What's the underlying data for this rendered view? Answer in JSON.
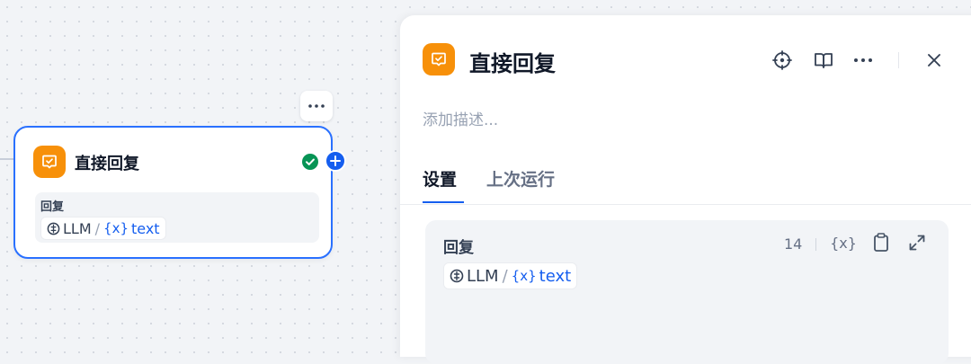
{
  "node": {
    "title": "直接回复",
    "field_label": "回复",
    "source": "LLM",
    "separator": "/",
    "var_prefix": "{x}",
    "variable": "text",
    "icons": [
      "reply-icon",
      "success-check-icon",
      "add-icon",
      "more-icon"
    ],
    "colors": {
      "accent": "#155eef",
      "icon_bg": "#f79009",
      "success": "#079455",
      "border": "#2970ff"
    }
  },
  "panel": {
    "title": "直接回复",
    "description_placeholder": "添加描述...",
    "tabs": [
      {
        "label": "设置",
        "active": true
      },
      {
        "label": "上次运行",
        "active": false
      }
    ],
    "header_icons": [
      "locate-icon",
      "book-icon",
      "more-icon",
      "close-icon"
    ],
    "reply": {
      "label": "回复",
      "count": "14",
      "source": "LLM",
      "separator": "/",
      "var_prefix": "{x}",
      "variable": "text",
      "tool_icons": [
        "insert-variable-icon",
        "copy-icon",
        "expand-icon"
      ]
    }
  }
}
